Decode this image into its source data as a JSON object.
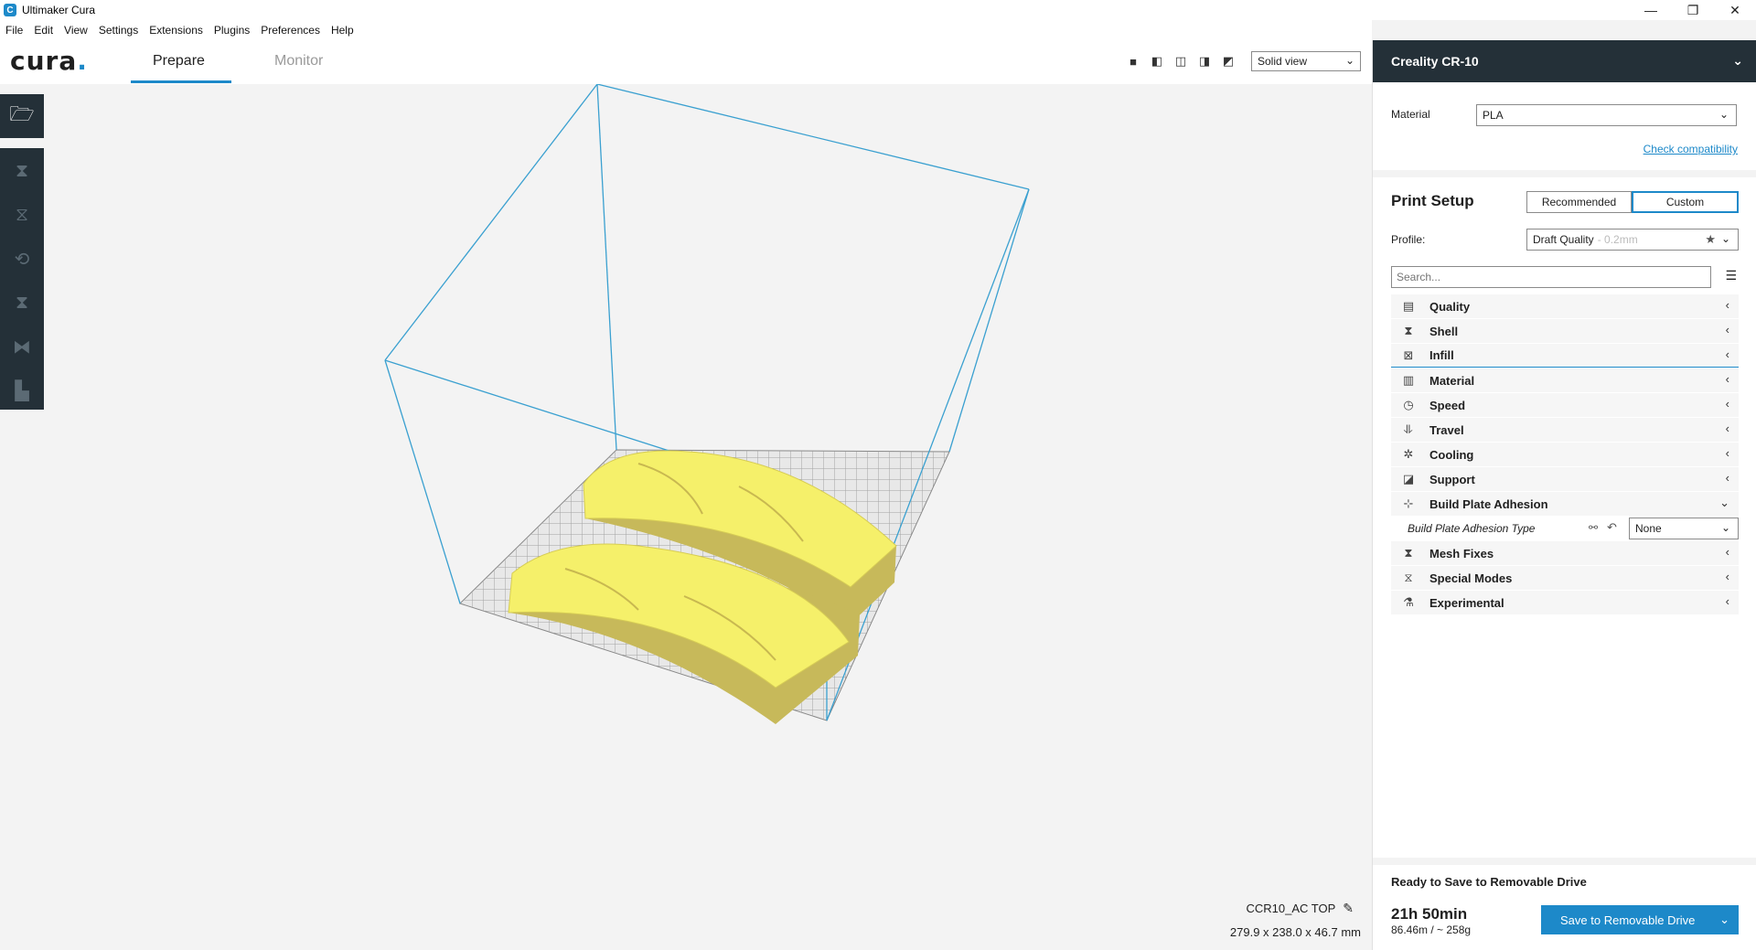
{
  "window": {
    "title": "Ultimaker Cura",
    "minimize": "—",
    "maximize": "❐",
    "close": "✕"
  },
  "menu": [
    "File",
    "Edit",
    "View",
    "Settings",
    "Extensions",
    "Plugins",
    "Preferences",
    "Help"
  ],
  "header": {
    "logo": "cura",
    "logo_dot": ".",
    "tabs": [
      {
        "label": "Prepare",
        "active": true
      },
      {
        "label": "Monitor",
        "active": false
      }
    ],
    "view_mode": "Solid view"
  },
  "viewport": {
    "object_name": "CCR10_AC TOP",
    "object_dims": "279.9 x 238.0 x 46.7 mm"
  },
  "panel": {
    "printer": "Creality CR-10",
    "material_label": "Material",
    "material_value": "PLA",
    "check_compat": "Check compatibility",
    "print_setup_title": "Print Setup",
    "mode_recommended": "Recommended",
    "mode_custom": "Custom",
    "profile_label": "Profile:",
    "profile_value": "Draft Quality",
    "profile_sub": "- 0.2mm",
    "search_placeholder": "Search...",
    "categories": [
      {
        "name": "Quality",
        "icon": "quality-icon"
      },
      {
        "name": "Shell",
        "icon": "shell-icon"
      },
      {
        "name": "Infill",
        "icon": "infill-icon"
      },
      {
        "name": "Material",
        "icon": "material-icon"
      },
      {
        "name": "Speed",
        "icon": "speed-icon"
      },
      {
        "name": "Travel",
        "icon": "travel-icon"
      },
      {
        "name": "Cooling",
        "icon": "cooling-icon"
      },
      {
        "name": "Support",
        "icon": "support-icon"
      },
      {
        "name": "Build Plate Adhesion",
        "icon": "adhesion-icon"
      },
      {
        "name": "Mesh Fixes",
        "icon": "mesh-fixes-icon"
      },
      {
        "name": "Special Modes",
        "icon": "special-modes-icon"
      },
      {
        "name": "Experimental",
        "icon": "experimental-icon"
      }
    ],
    "adhesion_setting": {
      "label": "Build Plate Adhesion Type",
      "value": "None"
    },
    "ready_text": "Ready to Save to Removable Drive",
    "print_time": "21h 50min",
    "usage": "86.46m / ~ 258g",
    "save_button": "Save to Removable Drive"
  },
  "colors": {
    "accent": "#1d89c9",
    "dark": "#243038",
    "model": "#f5f06a",
    "model_side": "#c7b95a"
  }
}
